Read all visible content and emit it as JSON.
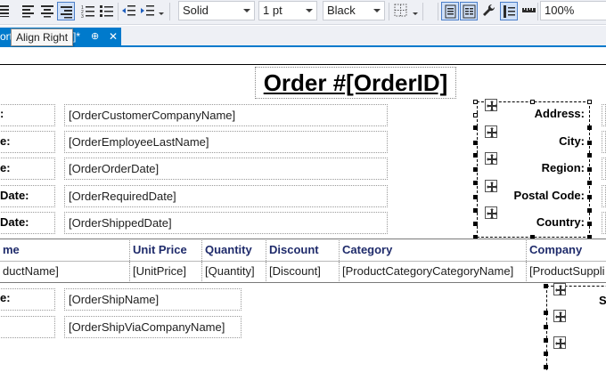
{
  "toolbar": {
    "border_style": "Solid",
    "border_width": "1 pt",
    "border_color": "Black",
    "zoom": "100%",
    "tooltip": "Align Right"
  },
  "tab": {
    "label": "ort",
    "suffix": "]*",
    "pin": "⊕",
    "close": "✕"
  },
  "report": {
    "title": "Order #[OrderID]",
    "left_labels": [
      ":",
      "e:",
      "e:",
      "Date:",
      "Date:"
    ],
    "left_fields": [
      "[OrderCustomerCompanyName]",
      "[OrderEmployeeLastName]",
      "[OrderOrderDate]",
      "[OrderRequiredDate]",
      "[OrderShippedDate]"
    ],
    "right_labels": [
      "Address:",
      "City:",
      "Region:",
      "Postal Code:",
      "Country:"
    ],
    "grid_headers": [
      "me",
      "Unit Price",
      "Quantity",
      "Discount",
      "Category",
      "Company"
    ],
    "grid_cells": [
      "ductName]",
      "[UnitPrice]",
      "[Quantity]",
      "[Discount]",
      "[ProductCategoryCategoryName]",
      "[ProductSuppli"
    ],
    "bottom_labels": [
      "e:",
      ""
    ],
    "bottom_fields": [
      "[OrderShipName]",
      "[OrderShipViaCompanyName]"
    ],
    "bottom_right_label": "S"
  },
  "colors": {
    "accent": "#007acc",
    "grid_header_text": "#1f2b6b"
  }
}
